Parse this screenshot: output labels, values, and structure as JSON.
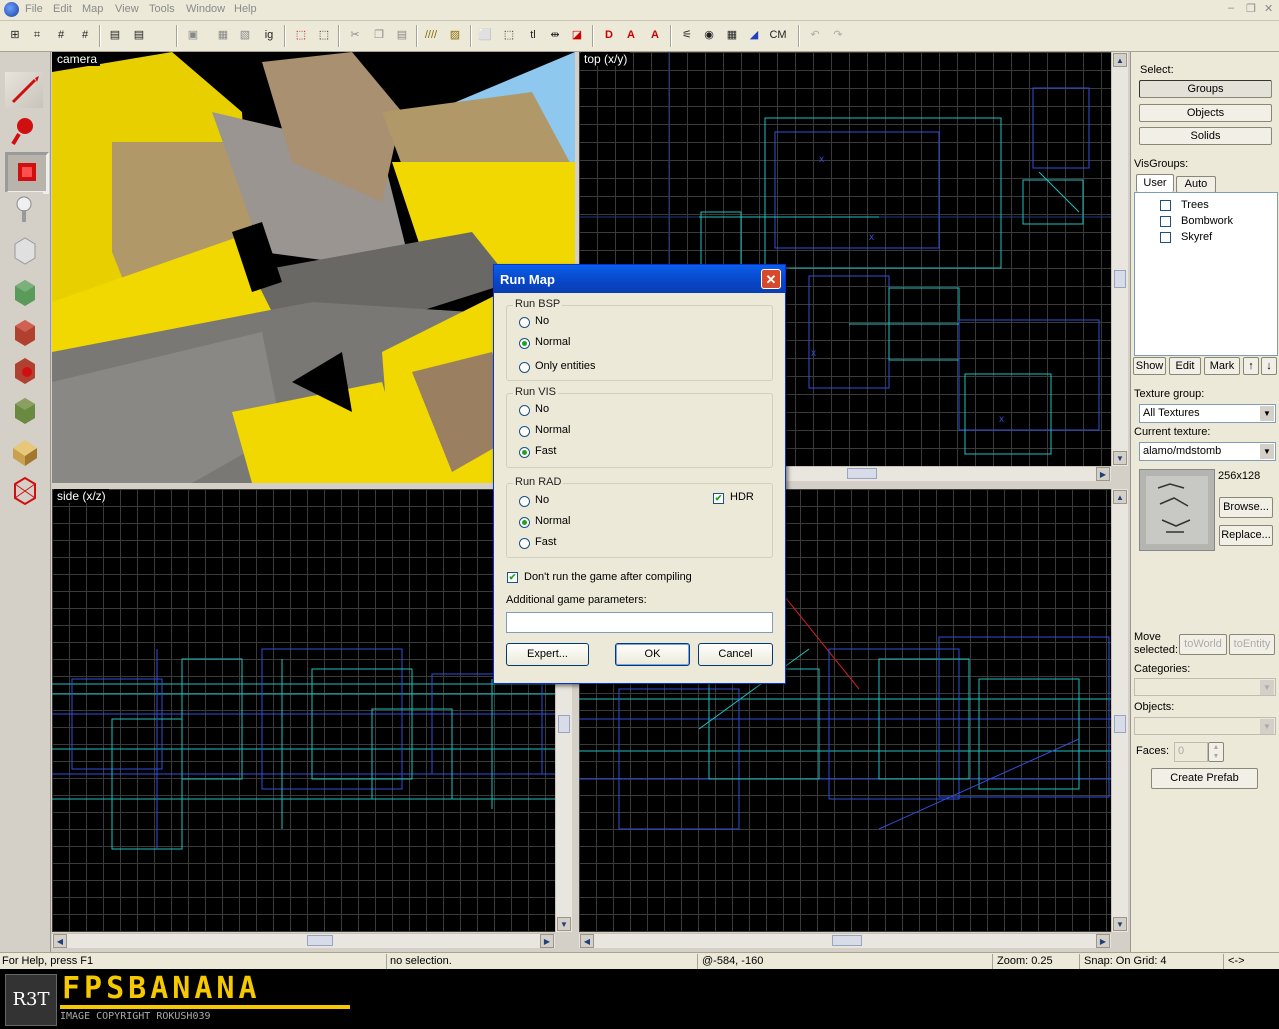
{
  "menu": [
    "File",
    "Edit",
    "Map",
    "View",
    "Tools",
    "Window",
    "Help"
  ],
  "toolbar_text": {
    "tl": "tl",
    "cm": "CM",
    "ig": "ig"
  },
  "viewports": {
    "camera": "camera",
    "top": "top (x/y)",
    "side": "side (x/z)"
  },
  "right_panel": {
    "select_label": "Select:",
    "select_buttons": [
      "Groups",
      "Objects",
      "Solids"
    ],
    "visgroups_label": "VisGroups:",
    "tabs": [
      "User",
      "Auto"
    ],
    "visgroups": [
      "Trees",
      "Bombwork",
      "Skyref"
    ],
    "vis_buttons": {
      "show": "Show",
      "edit": "Edit",
      "mark": "Mark"
    },
    "texture_group_label": "Texture group:",
    "texture_group_value": "All Textures",
    "current_texture_label": "Current texture:",
    "current_texture_value": "alamo/mdstomb",
    "texture_size": "256x128",
    "browse": "Browse...",
    "replace": "Replace...",
    "move_selected": "Move selected:",
    "to_world": "toWorld",
    "to_entity": "toEntity",
    "categories_label": "Categories:",
    "objects_label": "Objects:",
    "faces_label": "Faces:",
    "faces_value": "0",
    "create_prefab": "Create Prefab"
  },
  "dialog": {
    "title": "Run Map",
    "run_bsp": {
      "label": "Run BSP",
      "options": [
        "No",
        "Normal",
        "Only entities"
      ],
      "selected": "Normal"
    },
    "run_vis": {
      "label": "Run VIS",
      "options": [
        "No",
        "Normal",
        "Fast"
      ],
      "selected": "Fast"
    },
    "run_rad": {
      "label": "Run RAD",
      "options": [
        "No",
        "Normal",
        "Fast"
      ],
      "selected": "Normal",
      "hdr_label": "HDR",
      "hdr_checked": true
    },
    "dont_run_label": "Don't run the game after compiling",
    "dont_run_checked": true,
    "params_label": "Additional game parameters:",
    "params_value": "",
    "expert": "Expert...",
    "ok": "OK",
    "cancel": "Cancel"
  },
  "status": {
    "help": "For Help, press F1",
    "selection": "no selection.",
    "coords": "@-584, -160",
    "zoom": "Zoom: 0.25",
    "snap": "Snap: On Grid: 4",
    "arrows": "<->"
  },
  "banner": {
    "logo_text": "R3T",
    "brand": "FPSBANANA",
    "copyright": "IMAGE COPYRIGHT ROKUSH039"
  },
  "colors": {
    "grid": "#3c3c3c",
    "brush_blue": "#3050d8",
    "brush_cyan": "#20c0c0",
    "banner_yellow": "#f5c800",
    "title_blue": "#0a5fe8"
  }
}
